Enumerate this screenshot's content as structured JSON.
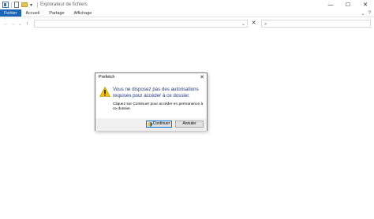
{
  "titlebar": {
    "title": "Explorateur de fichiers",
    "caret": "▾",
    "minimize": "—",
    "maximize": "☐",
    "close": "✕"
  },
  "ribbon": {
    "tabs": [
      "Fichier",
      "Accueil",
      "Partage",
      "Affichage"
    ],
    "expand": "⌄",
    "help": "?"
  },
  "nav": {
    "back": "←",
    "forward": "→",
    "recent": "⌄",
    "up": "↑"
  },
  "address": {
    "value": "",
    "dropdown": "⌄",
    "clear": "✕"
  },
  "search": {
    "icon": "⌕",
    "placeholder": ""
  },
  "dialog": {
    "title": "Prefetch",
    "close": "✕",
    "main_instruction": "Vous ne disposez pas des autorisations requises pour accéder à ce dossier.",
    "content": "Cliquez sur Continuer pour accéder en permanence à ce dossier.",
    "continue_label": "Continuer",
    "cancel_label": "Annuler",
    "warning_color": "#f2c200",
    "accent_color": "#0078d7"
  }
}
